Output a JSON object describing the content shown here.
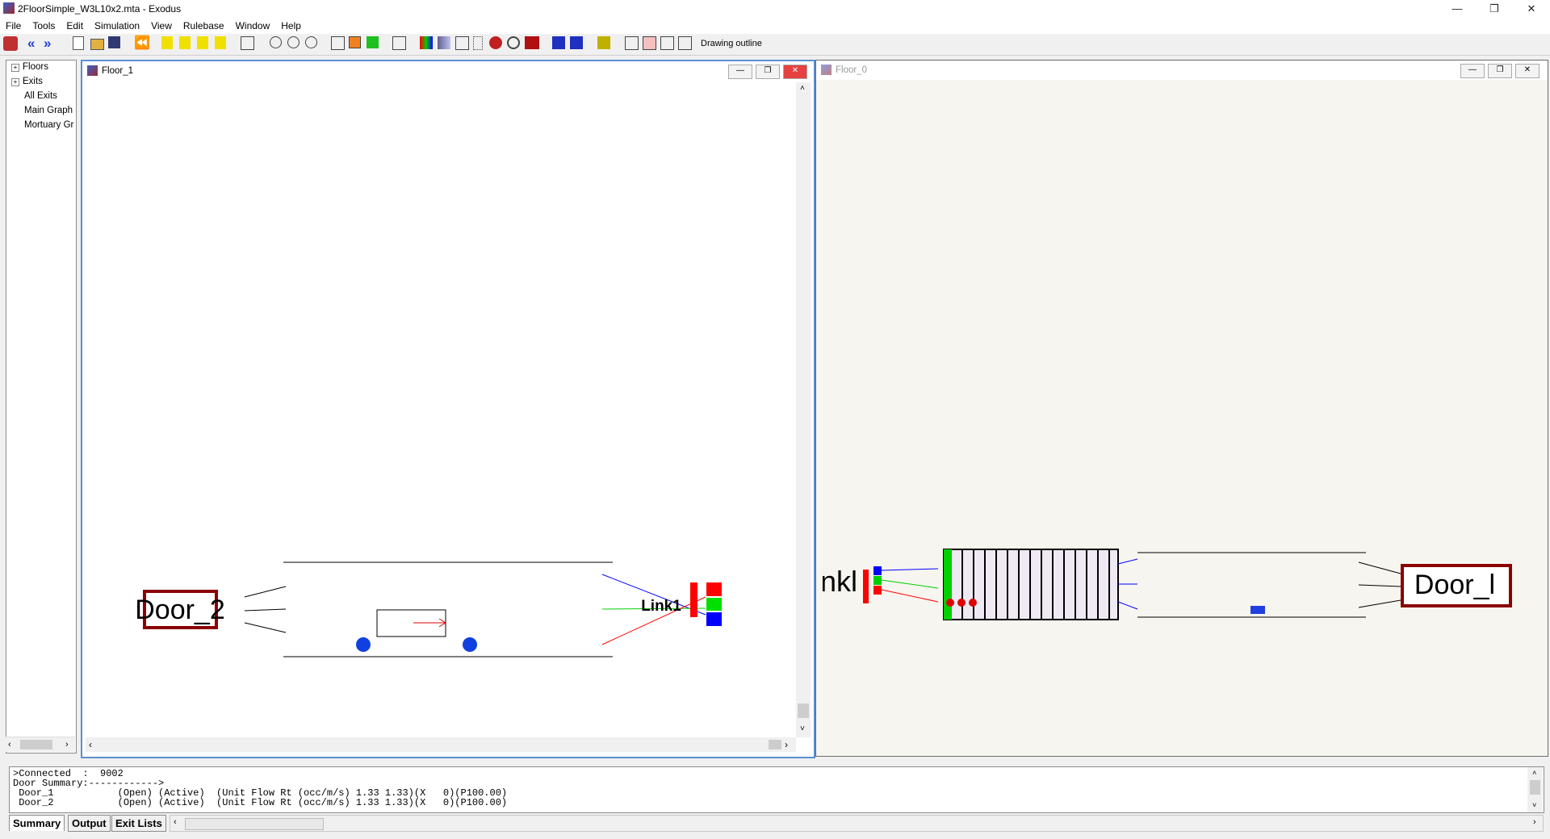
{
  "window": {
    "title": "2FloorSimple_W3L10x2.mta - Exodus"
  },
  "menu": [
    "File",
    "Tools",
    "Edit",
    "Simulation",
    "View",
    "Rulebase",
    "Window",
    "Help"
  ],
  "toolbar": {
    "status": "Drawing outline"
  },
  "tree": {
    "items": [
      {
        "label": "Floors",
        "expandable": true
      },
      {
        "label": "Exits",
        "expandable": true
      },
      {
        "label": "All Exits",
        "expandable": false
      },
      {
        "label": "Main Graph",
        "expandable": false
      },
      {
        "label": "Mortuary Gr",
        "expandable": false
      }
    ]
  },
  "floor1": {
    "title": "Floor_1",
    "door_label": "Door_2",
    "link_label": "Link1"
  },
  "floor0": {
    "title": "Floor_0",
    "link_label": "nkl",
    "door_label": "Door_l"
  },
  "console": {
    "lines": [
      ">Connected  :  9002",
      "Door Summary:------------>",
      " Door_1           (Open) (Active)  (Unit Flow Rt (occ/m/s) 1.33 1.33)(X   0)(P100.00)",
      " Door_2           (Open) (Active)  (Unit Flow Rt (occ/m/s) 1.33 1.33)(X   0)(P100.00)"
    ]
  },
  "bottom_tabs": [
    "Summary",
    "Output",
    "Exit Lists"
  ],
  "colors": {
    "door_border": "#8b0000",
    "link_red": "#ff0000",
    "link_green": "#00d000",
    "link_blue": "#0000ff"
  }
}
